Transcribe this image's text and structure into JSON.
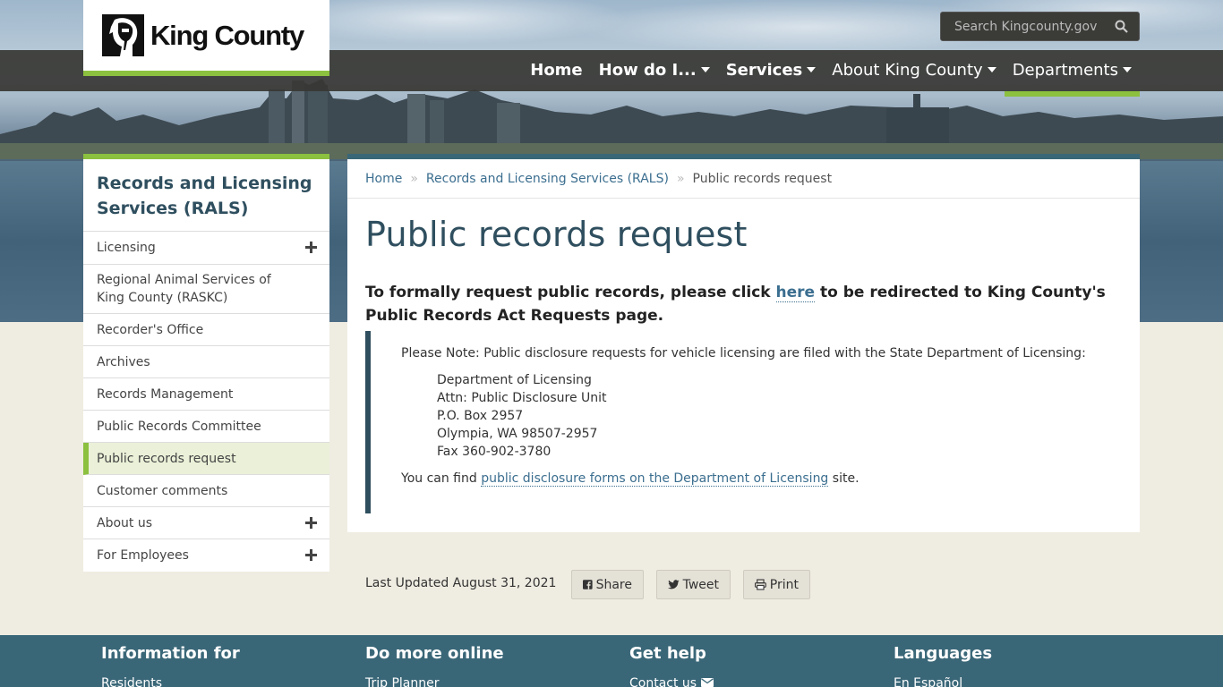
{
  "header": {
    "brand": "King County",
    "search_placeholder": "Search Kingcounty.gov",
    "nav": [
      {
        "label": "Home"
      },
      {
        "label": "How do I..."
      },
      {
        "label": "Services"
      },
      {
        "label": "About King County"
      },
      {
        "label": "Departments"
      }
    ]
  },
  "sidebar": {
    "title": "Records and Licensing Services (RALS)",
    "items": [
      {
        "label": "Licensing"
      },
      {
        "label": "Regional Animal Services of King County (RASKC)"
      },
      {
        "label": "Recorder's Office"
      },
      {
        "label": "Archives"
      },
      {
        "label": "Records Management"
      },
      {
        "label": "Public Records Committee"
      },
      {
        "label": "Public records request"
      },
      {
        "label": "Customer comments"
      },
      {
        "label": "About us"
      },
      {
        "label": "For Employees"
      }
    ]
  },
  "breadcrumb": {
    "home": "Home",
    "section": "Records and Licensing Services (RALS)",
    "current": "Public records request"
  },
  "main": {
    "title": "Public records request",
    "lead_before": "To formally request public records, please click ",
    "lead_link": "here",
    "lead_after": " to be redirected to King County's Public Records Act Requests page.",
    "note_intro": "Please Note: Public disclosure requests for vehicle licensing are filed with the State Department of Licensing:",
    "address": [
      "Department of Licensing",
      "Attn: Public Disclosure Unit",
      "P.O. Box 2957",
      "Olympia, WA 98507-2957",
      "Fax 360-902-3780"
    ],
    "find_before": "You can find ",
    "find_link": "public disclosure forms on the Department of Licensing",
    "find_after": " site."
  },
  "page_footer": {
    "last_updated": "Last Updated August 31, 2021",
    "share": "Share",
    "tweet": "Tweet",
    "print": "Print"
  },
  "footer": {
    "columns": [
      {
        "heading": "Information for",
        "link": "Residents"
      },
      {
        "heading": "Do more online",
        "link": "Trip Planner"
      },
      {
        "heading": "Get help",
        "link": "Contact us"
      },
      {
        "heading": "Languages",
        "link": "En Español"
      }
    ]
  },
  "colors": {
    "accent_green": "#8cc03f",
    "dark_teal": "#2f4f5f",
    "footer_teal": "#3a6778",
    "link": "#3b6e8f"
  }
}
